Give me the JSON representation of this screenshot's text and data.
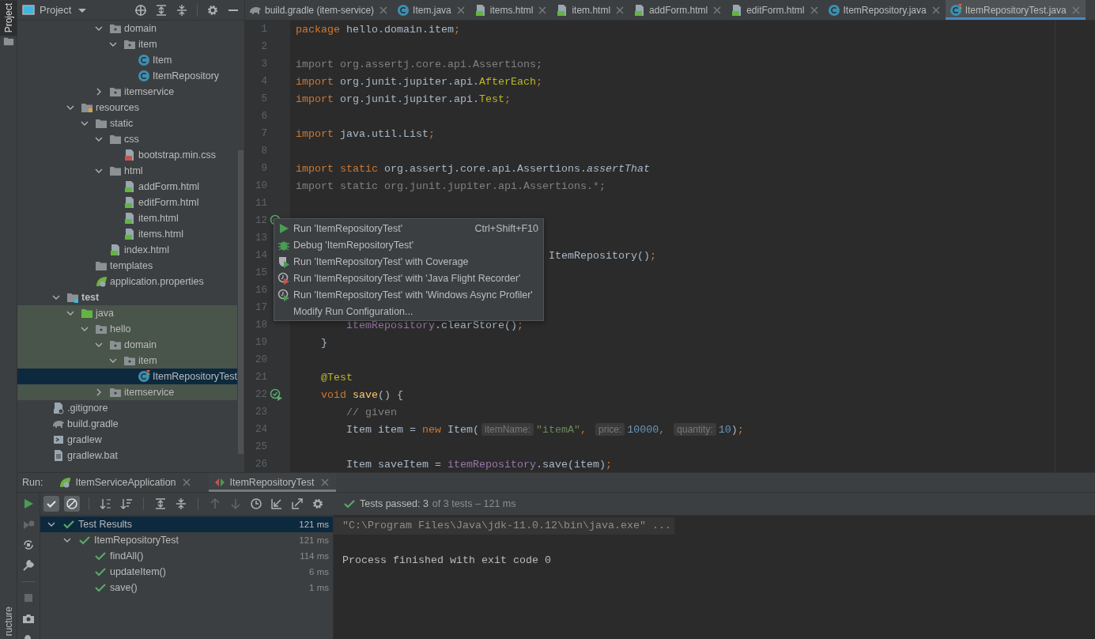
{
  "tool_strip": {
    "top": {
      "label": "Project",
      "selected": true
    },
    "bottom": {
      "label": "ructure",
      "selected": false
    }
  },
  "project": {
    "title": "Project",
    "tree": [
      {
        "children": [
          {
            "children": [
              {
                "children": [
                  {
                    "children": [
                      {
                        "children": [
                          {
                            "label": "domain",
                            "kind": "package",
                            "expanded": true,
                            "selected": false,
                            "children": [
                              {
                                "label": "item",
                                "kind": "package",
                                "expanded": true,
                                "selected": false,
                                "children": [
                                  {
                                    "label": "Item",
                                    "kind": "class",
                                    "selected": false
                                  },
                                  {
                                    "label": "ItemRepository",
                                    "kind": "class",
                                    "selected": false
                                  }
                                ]
                              }
                            ]
                          },
                          {
                            "label": "itemservice",
                            "kind": "package",
                            "expanded": false,
                            "selected": false
                          }
                        ]
                      }
                    ]
                  },
                  {
                    "label": "resources",
                    "kind": "resources",
                    "expanded": true,
                    "selected": false,
                    "children": [
                      {
                        "label": "static",
                        "kind": "folder",
                        "expanded": true,
                        "selected": false,
                        "children": [
                          {
                            "label": "css",
                            "kind": "folder",
                            "expanded": true,
                            "selected": false,
                            "children": [
                              {
                                "label": "bootstrap.min.css",
                                "kind": "css",
                                "selected": false
                              }
                            ]
                          },
                          {
                            "label": "html",
                            "kind": "folder",
                            "expanded": true,
                            "selected": false,
                            "children": [
                              {
                                "label": "addForm.html",
                                "kind": "html",
                                "selected": false
                              },
                              {
                                "label": "editForm.html",
                                "kind": "html",
                                "selected": false
                              },
                              {
                                "label": "item.html",
                                "kind": "html",
                                "selected": false
                              },
                              {
                                "label": "items.html",
                                "kind": "html",
                                "selected": false
                              }
                            ]
                          },
                          {
                            "label": "index.html",
                            "kind": "html",
                            "selected": false
                          }
                        ]
                      },
                      {
                        "label": "templates",
                        "kind": "folder",
                        "selected": false
                      },
                      {
                        "label": "application.properties",
                        "kind": "spring",
                        "selected": false
                      }
                    ]
                  }
                ]
              },
              {
                "label": "test",
                "kind": "test-root",
                "expanded": true,
                "selected": false,
                "children": [
                  {
                    "label": "java",
                    "kind": "test-sources",
                    "expanded": true,
                    "selected": false,
                    "children": [
                      {
                        "label": "hello",
                        "kind": "package",
                        "expanded": true,
                        "selected": false,
                        "children": [
                          {
                            "label": "domain",
                            "kind": "package",
                            "expanded": true,
                            "selected": false,
                            "children": [
                              {
                                "label": "item",
                                "kind": "package",
                                "expanded": true,
                                "selected": false,
                                "children": [
                                  {
                                    "label": "ItemRepositoryTest",
                                    "kind": "test-class",
                                    "selected": true
                                  }
                                ]
                              }
                            ]
                          },
                          {
                            "label": "itemservice",
                            "kind": "package",
                            "expanded": false,
                            "selected": false
                          }
                        ]
                      }
                    ]
                  }
                ]
              }
            ]
          },
          {
            "label": ".gitignore",
            "kind": "gitignore",
            "selected": false
          },
          {
            "label": "build.gradle",
            "kind": "gradle",
            "selected": false
          },
          {
            "label": "gradlew",
            "kind": "shell",
            "selected": false
          },
          {
            "label": "gradlew.bat",
            "kind": "bat",
            "selected": false
          }
        ]
      }
    ]
  },
  "editor": {
    "tabs": [
      {
        "label": "build.gradle (item-service)",
        "kind": "gradle",
        "selected": false
      },
      {
        "label": "Item.java",
        "kind": "class",
        "selected": false
      },
      {
        "label": "items.html",
        "kind": "html",
        "selected": false
      },
      {
        "label": "item.html",
        "kind": "html",
        "selected": false
      },
      {
        "label": "addForm.html",
        "kind": "html",
        "selected": false
      },
      {
        "label": "editForm.html",
        "kind": "html",
        "selected": false
      },
      {
        "label": "ItemRepository.java",
        "kind": "class",
        "selected": false
      },
      {
        "label": "ItemRepositoryTest.java",
        "kind": "test-class",
        "selected": true
      }
    ],
    "lines": [
      {
        "num": "1",
        "code": [
          {
            "text": "package",
            "kind": "kw"
          },
          {
            "text": " hello.domain.item",
            "kind": "pl"
          },
          {
            "text": ";",
            "kind": "kw"
          }
        ]
      },
      {
        "num": "2"
      },
      {
        "num": "3",
        "code": [
          {
            "text": "import org.assertj.core.api.Assertions;",
            "kind": "un"
          }
        ]
      },
      {
        "num": "4",
        "code": [
          {
            "text": "import",
            "kind": "kw"
          },
          {
            "text": " org.junit.jupiter.api.",
            "kind": "pl"
          },
          {
            "text": "AfterEach",
            "kind": "ann"
          },
          {
            "text": ";",
            "kind": "kw"
          }
        ]
      },
      {
        "num": "5",
        "code": [
          {
            "text": "import",
            "kind": "kw"
          },
          {
            "text": " org.junit.jupiter.api.",
            "kind": "pl"
          },
          {
            "text": "Test",
            "kind": "ann"
          },
          {
            "text": ";",
            "kind": "kw"
          }
        ]
      },
      {
        "num": "6"
      },
      {
        "num": "7",
        "code": [
          {
            "text": "import",
            "kind": "kw"
          },
          {
            "text": " java.util.List",
            "kind": "pl"
          },
          {
            "text": ";",
            "kind": "kw"
          }
        ]
      },
      {
        "num": "8"
      },
      {
        "num": "9",
        "code": [
          {
            "text": "import static",
            "kind": "kw"
          },
          {
            "text": " org.assertj.core.api.Assertions.",
            "kind": "pl"
          },
          {
            "text": "assertThat",
            "kind": "it"
          }
        ]
      },
      {
        "num": "10",
        "code": [
          {
            "text": "import static org.junit.jupiter.api.Assertions.*;",
            "kind": "un"
          }
        ]
      },
      {
        "num": "11"
      },
      {
        "num": "12",
        "kind": "run-marker"
      },
      {
        "num": "13"
      },
      {
        "num": "14",
        "code": [
          {
            "text": "                                        ItemRepository()",
            "kind": "pl"
          },
          {
            "text": ";",
            "kind": "kw"
          }
        ]
      },
      {
        "num": "15"
      },
      {
        "num": "16"
      },
      {
        "num": "17"
      },
      {
        "num": "18",
        "code": [
          {
            "text": "        itemRepository",
            "kind": "fld"
          },
          {
            "text": ".clearStore()",
            "kind": "pl"
          },
          {
            "text": ";",
            "kind": "kw"
          }
        ]
      },
      {
        "num": "19",
        "code": [
          {
            "text": "    }",
            "kind": "pl"
          }
        ]
      },
      {
        "num": "20"
      },
      {
        "num": "21",
        "code": [
          {
            "text": "    @Test",
            "kind": "ann"
          }
        ]
      },
      {
        "num": "22",
        "kind": "run-marker",
        "code": [
          {
            "text": "    void ",
            "kind": "kw"
          },
          {
            "text": "save",
            "kind": "meth"
          },
          {
            "text": "() {",
            "kind": "pl"
          }
        ]
      },
      {
        "num": "23",
        "code": [
          {
            "text": "        // given",
            "kind": "com"
          }
        ]
      },
      {
        "num": "24",
        "code": [
          {
            "text": "        Item item = ",
            "kind": "pl"
          },
          {
            "text": "new",
            "kind": "kw"
          },
          {
            "text": " Item(",
            "kind": "pl"
          },
          {
            "text": "itemName:",
            "kind": "hint"
          },
          {
            "text": "\"itemA\"",
            "kind": "str"
          },
          {
            "text": ", ",
            "kind": "kw"
          },
          {
            "text": "price:",
            "kind": "hint"
          },
          {
            "text": "10000",
            "kind": "num"
          },
          {
            "text": ", ",
            "kind": "kw"
          },
          {
            "text": "quantity:",
            "kind": "hint"
          },
          {
            "text": "10",
            "kind": "num"
          },
          {
            "text": ")",
            "kind": "pl"
          },
          {
            "text": ";",
            "kind": "kw"
          }
        ]
      },
      {
        "num": "25"
      },
      {
        "num": "26",
        "code": [
          {
            "text": "        Item saveItem = ",
            "kind": "pl"
          },
          {
            "text": "itemRepository",
            "kind": "fld"
          },
          {
            "text": ".save(item)",
            "kind": "pl"
          },
          {
            "text": ";",
            "kind": "kw"
          }
        ]
      }
    ],
    "popup": [
      {
        "kind": "play",
        "label": "Run 'ItemRepositoryTest'",
        "shortcut": "Ctrl+Shift+F10"
      },
      {
        "kind": "bug",
        "label": "Debug 'ItemRepositoryTest'"
      },
      {
        "kind": "coverage",
        "label": "Run 'ItemRepositoryTest' with Coverage"
      },
      {
        "kind": "jfr",
        "label": "Run 'ItemRepositoryTest' with 'Java Flight Recorder'"
      },
      {
        "kind": "async",
        "label": "Run 'ItemRepositoryTest' with 'Windows Async Profiler'"
      },
      {
        "label": "Modify Run Configuration..."
      }
    ]
  },
  "run_panel": {
    "label": "Run:",
    "tabs": [
      {
        "label": "ItemServiceApplication",
        "kind": "spring",
        "selected": false
      },
      {
        "label": "ItemRepositoryTest",
        "kind": "test-config",
        "selected": true
      }
    ],
    "side_tools": [
      {
        "kind": "play",
        "disabled": false
      },
      {
        "kind": "rerun-failed",
        "disabled": true
      },
      {
        "kind": "toggle-auto",
        "disabled": false
      },
      {
        "kind": "wrench",
        "disabled": false
      },
      {
        "kind": "stop",
        "disabled": true
      },
      {
        "kind": "camera",
        "disabled": false
      },
      {
        "kind": "bug-arrow",
        "disabled": false
      }
    ],
    "filters": [
      {
        "kind": "show-passed",
        "on": true
      },
      {
        "kind": "show-ignored",
        "on": true
      }
    ],
    "tools": [
      {
        "kind": "sort-alpha",
        "disabled": false
      },
      {
        "kind": "sort-duration",
        "disabled": false
      },
      {
        "kind": "sep"
      },
      {
        "kind": "expand",
        "disabled": false
      },
      {
        "kind": "collapse",
        "disabled": false
      },
      {
        "kind": "sep"
      },
      {
        "kind": "up",
        "disabled": true
      },
      {
        "kind": "down",
        "disabled": true
      },
      {
        "kind": "clock",
        "disabled": false
      },
      {
        "kind": "import",
        "disabled": false
      },
      {
        "kind": "export",
        "disabled": false
      },
      {
        "kind": "gear",
        "disabled": false
      }
    ],
    "status": {
      "passed": "Tests passed: 3",
      "detail": "of 3 tests – 121 ms"
    },
    "results": [
      {
        "label": "Test Results",
        "time": "121 ms",
        "kind": "passed",
        "expanded": true,
        "selected": true,
        "children": [
          {
            "label": "ItemRepositoryTest",
            "time": "121 ms",
            "kind": "passed",
            "expanded": true,
            "selected": false,
            "children": [
              {
                "label": "findAll()",
                "time": "114 ms",
                "kind": "passed",
                "selected": false
              },
              {
                "label": "updateItem()",
                "time": "6 ms",
                "kind": "passed",
                "selected": false
              },
              {
                "label": "save()",
                "time": "1 ms",
                "kind": "passed",
                "selected": false
              }
            ]
          }
        ]
      }
    ],
    "console": [
      {
        "text": "\"C:\\Program Files\\Java\\jdk-11.0.12\\bin\\java.exe\" ...",
        "kind": "command"
      },
      {
        "text": "Process finished with exit code 0",
        "kind": "output"
      }
    ]
  }
}
